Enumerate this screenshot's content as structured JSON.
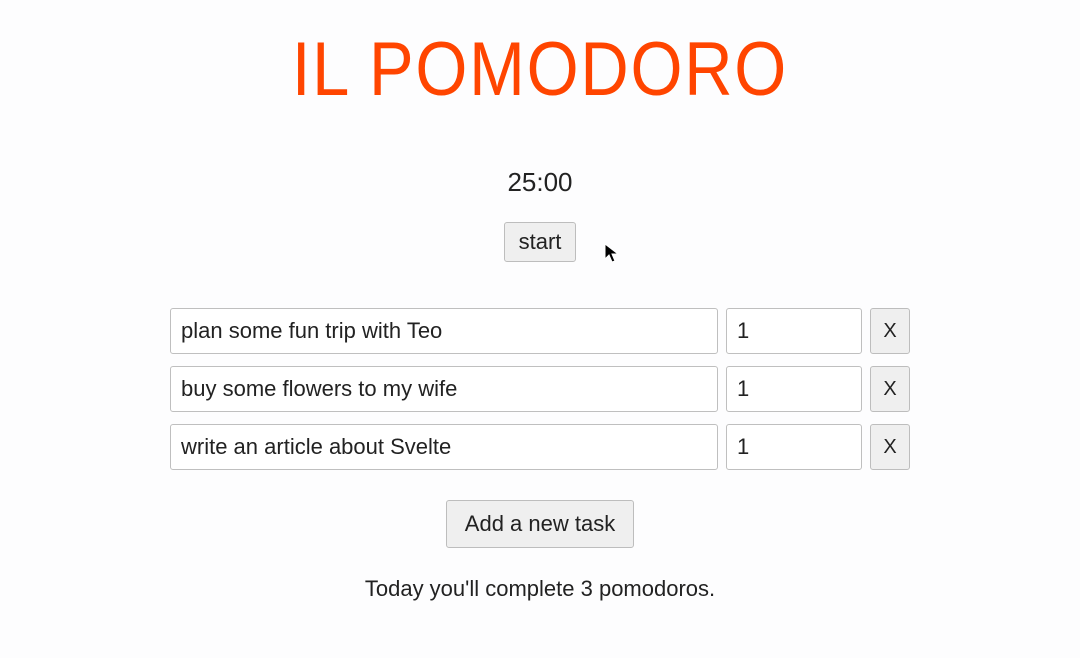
{
  "title": "IL POMODORO",
  "timer": {
    "display": "25:00",
    "start_label": "start"
  },
  "tasks": [
    {
      "name": "plan some fun trip with Teo",
      "count": "1",
      "delete_label": "X"
    },
    {
      "name": "buy some flowers to my wife",
      "count": "1",
      "delete_label": "X"
    },
    {
      "name": "write an article about Svelte",
      "count": "1",
      "delete_label": "X"
    }
  ],
  "add_task_label": "Add a new task",
  "summary": "Today you'll complete 3 pomodoros.",
  "colors": {
    "accent": "#ff4500"
  }
}
